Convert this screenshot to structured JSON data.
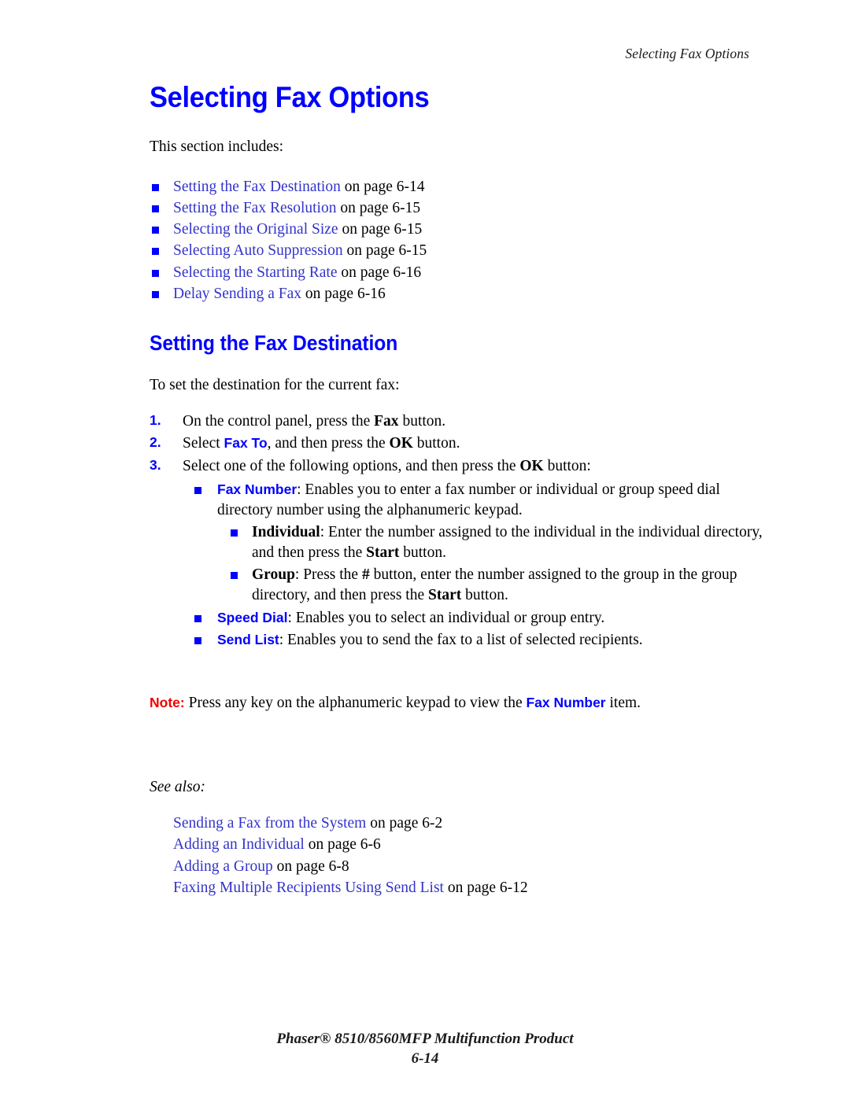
{
  "header": {
    "running_head": "Selecting Fax Options"
  },
  "title": "Selecting Fax Options",
  "intro": "This section includes:",
  "section_toc": [
    {
      "link": "Setting the Fax Destination",
      "tail": " on page 6-14"
    },
    {
      "link": "Setting the Fax Resolution",
      "tail": " on page 6-15"
    },
    {
      "link": "Selecting the Original Size",
      "tail": " on page 6-15"
    },
    {
      "link": "Selecting Auto Suppression",
      "tail": " on page 6-15"
    },
    {
      "link": "Selecting the Starting Rate",
      "tail": " on page 6-16"
    },
    {
      "link": "Delay Sending a Fax",
      "tail": " on page 6-16"
    }
  ],
  "section": {
    "heading": "Setting the Fax Destination",
    "intro": "To set the destination for the current fax:",
    "steps": [
      {
        "num": "1.",
        "pre": "On the control panel, press the ",
        "kbd": "Fax",
        "post": " button."
      },
      {
        "num": "2.",
        "pre": "Select ",
        "ui": "Fax To",
        "mid": ", and then press the ",
        "kbd": "OK",
        "post": " button."
      },
      {
        "num": "3.",
        "pre": "Select one of the following options, and then press the ",
        "kbd": "OK",
        "post": " button:"
      }
    ],
    "options": [
      {
        "ui_term": "Fax Number",
        "text": ": Enables you to enter a fax number or individual or group speed dial directory number using the alphanumeric keypad."
      },
      {
        "ui_term": "Speed Dial",
        "text": ": Enables you to select an individual or group entry."
      },
      {
        "ui_term": "Send List",
        "text": ": Enables you to send the fax to a list of selected recipients."
      }
    ],
    "sub_options": [
      {
        "lead": "Individual",
        "pre": ": Enter the number assigned to the individual in the individual directory, and then press the ",
        "kbd": "Start",
        "post": " button."
      },
      {
        "lead": "Group",
        "pre": ": Press the ",
        "kbd_mid": "#",
        "mid": " button, enter the number assigned to the group in the group directory, and then press the ",
        "kbd": "Start",
        "post": " button."
      }
    ],
    "note": {
      "label": "Note:",
      "pre": " Press any key on the alphanumeric keypad to view the ",
      "ui_term": "Fax Number",
      "post": " item."
    },
    "see_also_label": "See also:",
    "see_also": [
      {
        "link": "Sending a Fax from the System",
        "tail": " on page 6-2"
      },
      {
        "link": "Adding an Individual",
        "tail": " on page 6-6"
      },
      {
        "link": "Adding a Group",
        "tail": " on page 6-8"
      },
      {
        "link": "Faxing Multiple Recipients Using Send List",
        "tail": " on page 6-12"
      }
    ]
  },
  "footer": {
    "product": "Phaser® 8510/8560MFP Multifunction Product",
    "page_number": "6-14"
  },
  "colors": {
    "link_blue": "#3333cc",
    "heading_blue": "#0000ff",
    "ui_term_blue": "#0000ff",
    "note_red": "#ee0000"
  }
}
